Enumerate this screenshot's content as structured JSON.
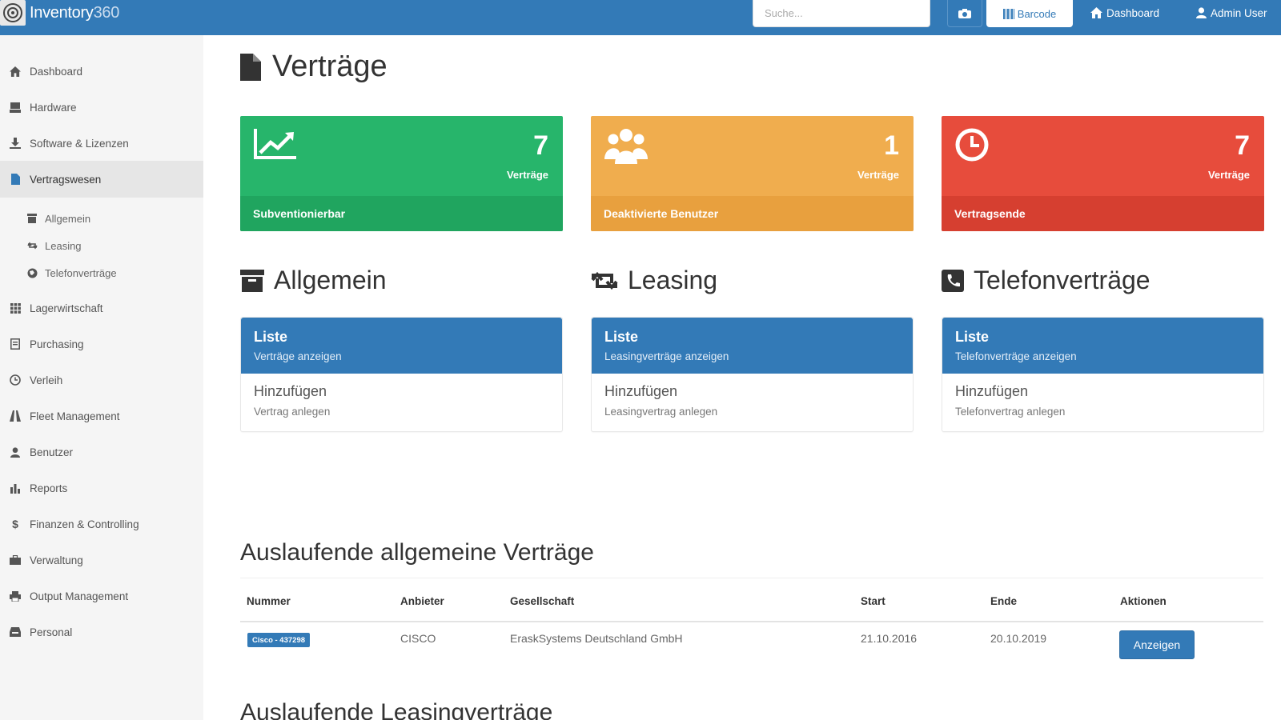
{
  "app": {
    "name_main": "Inventory",
    "name_suffix": "360"
  },
  "topbar": {
    "search_placeholder": "Suche...",
    "barcode_label": "Barcode",
    "dashboard_label": "Dashboard",
    "user_label": "Admin User"
  },
  "sidebar": {
    "items": [
      {
        "label": "Dashboard",
        "icon": "home-icon"
      },
      {
        "label": "Hardware",
        "icon": "hardware-icon"
      },
      {
        "label": "Software & Lizenzen",
        "icon": "download-icon"
      },
      {
        "label": "Vertragswesen",
        "icon": "file-icon",
        "active": true
      },
      {
        "label": "Lagerwirtschaft",
        "icon": "grid-icon"
      },
      {
        "label": "Purchasing",
        "icon": "receipt-icon"
      },
      {
        "label": "Verleih",
        "icon": "clock-icon"
      },
      {
        "label": "Fleet Management",
        "icon": "road-icon"
      },
      {
        "label": "Benutzer",
        "icon": "user-icon"
      },
      {
        "label": "Reports",
        "icon": "bar-chart-icon"
      },
      {
        "label": "Finanzen & Controlling",
        "icon": "dollar-icon"
      },
      {
        "label": "Verwaltung",
        "icon": "briefcase-icon"
      },
      {
        "label": "Output Management",
        "icon": "printer-icon"
      },
      {
        "label": "Personal",
        "icon": "inbox-icon"
      }
    ],
    "subitems": [
      {
        "label": "Allgemein",
        "icon": "archive-icon"
      },
      {
        "label": "Leasing",
        "icon": "retweet-icon"
      },
      {
        "label": "Telefonverträge",
        "icon": "globe-icon"
      }
    ]
  },
  "page": {
    "title": "Verträge"
  },
  "tiles": [
    {
      "count": "7",
      "unit": "Verträge",
      "label": "Subventionierbar",
      "color": "#27b56b",
      "icon": "trend-chart-icon"
    },
    {
      "count": "1",
      "unit": "Verträge",
      "label": "Deaktivierte Benutzer",
      "color": "#f0ad4e",
      "icon": "users-icon"
    },
    {
      "count": "7",
      "unit": "Verträge",
      "label": "Vertragsende",
      "color": "#e74c3c",
      "icon": "clock-icon"
    }
  ],
  "sections": [
    {
      "title": "Allgemein",
      "head_title": "Liste",
      "head_sub": "Verträge anzeigen",
      "body_title": "Hinzufügen",
      "body_sub": "Vertrag anlegen"
    },
    {
      "title": "Leasing",
      "head_title": "Liste",
      "head_sub": "Leasingverträge anzeigen",
      "body_title": "Hinzufügen",
      "body_sub": "Leasingvertrag anlegen"
    },
    {
      "title": "Telefonverträge",
      "head_title": "Liste",
      "head_sub": "Telefonverträge anzeigen",
      "body_title": "Hinzufügen",
      "body_sub": "Telefonvertrag anlegen"
    }
  ],
  "expiring": {
    "title": "Auslaufende allgemeine Verträge",
    "columns": [
      "Nummer",
      "Anbieter",
      "Gesellschaft",
      "Start",
      "Ende",
      "Aktionen"
    ],
    "rows": [
      {
        "nummer": "Cisco - 437298",
        "anbieter": "CISCO",
        "gesellschaft": "EraskSystems Deutschland GmbH",
        "start": "21.10.2016",
        "ende": "20.10.2019",
        "action": "Anzeigen"
      }
    ]
  },
  "leasing_expiring": {
    "title": "Auslaufende Leasingverträge"
  },
  "colors": {
    "primary": "#337ab7",
    "success": "#27b56b",
    "warning": "#f0ad4e",
    "danger": "#e74c3c"
  }
}
